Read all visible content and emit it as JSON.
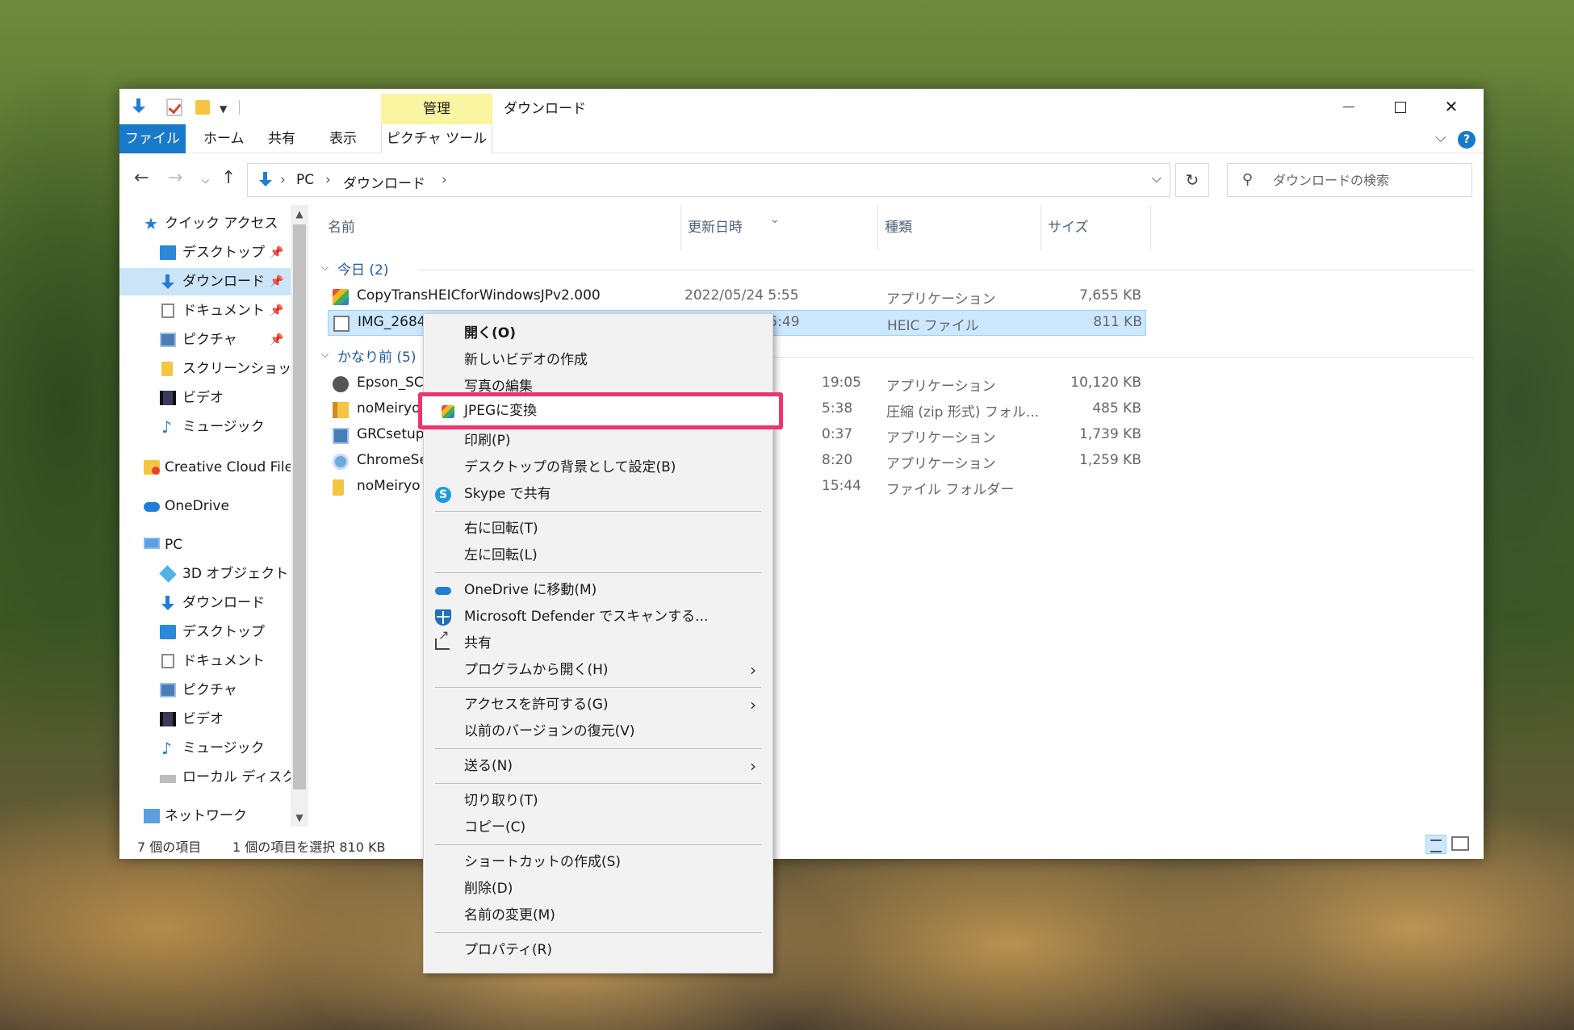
{
  "window": {
    "title": "ダウンロード",
    "manage_tab": "管理",
    "help": "?"
  },
  "ribbon": {
    "tabs": [
      "ファイル",
      "ホーム",
      "共有",
      "表示",
      "ピクチャ ツール"
    ]
  },
  "address": {
    "crumbs": [
      "PC",
      "ダウンロード"
    ],
    "separator": "›"
  },
  "search": {
    "placeholder": "ダウンロードの検索"
  },
  "navpane": {
    "items": [
      {
        "label": "クイック アクセス",
        "icon": "star-icon"
      },
      {
        "label": "デスクトップ",
        "icon": "desktop-icon",
        "pinned": true
      },
      {
        "label": "ダウンロード",
        "icon": "download-icon",
        "pinned": true,
        "selected": true
      },
      {
        "label": "ドキュメント",
        "icon": "document-icon",
        "pinned": true
      },
      {
        "label": "ピクチャ",
        "icon": "pictures-icon",
        "pinned": true
      },
      {
        "label": "スクリーンショット",
        "icon": "folder-icon"
      },
      {
        "label": "ビデオ",
        "icon": "video-icon"
      },
      {
        "label": "ミュージック",
        "icon": "music-icon"
      },
      {
        "label": "Creative Cloud Files",
        "icon": "creative-cloud-icon"
      },
      {
        "label": "OneDrive",
        "icon": "onedrive-icon"
      },
      {
        "label": "PC",
        "icon": "pc-icon"
      },
      {
        "label": "3D オブジェクト",
        "icon": "3d-objects-icon"
      },
      {
        "label": "ダウンロード",
        "icon": "download-icon"
      },
      {
        "label": "デスクトップ",
        "icon": "desktop-icon"
      },
      {
        "label": "ドキュメント",
        "icon": "document-icon"
      },
      {
        "label": "ピクチャ",
        "icon": "pictures-icon"
      },
      {
        "label": "ビデオ",
        "icon": "video-icon"
      },
      {
        "label": "ミュージック",
        "icon": "music-icon"
      },
      {
        "label": "ローカル ディスク (C:)",
        "icon": "local-disk-icon"
      },
      {
        "label": "ネットワーク",
        "icon": "network-icon"
      }
    ]
  },
  "columns": {
    "name": "名前",
    "date": "更新日時",
    "type": "種類",
    "size": "サイズ"
  },
  "groups": {
    "today": "今日 (2)",
    "long_ago": "かなり前 (5)"
  },
  "files_today": [
    {
      "name": "CopyTransHEICforWindowsJPv2.000",
      "date": "2022/05/24 5:55",
      "type": "アプリケーション",
      "size": "7,655 KB",
      "icon": "heic-app-icon"
    },
    {
      "name": "IMG_2684",
      "date": "2022/05/24 5:49",
      "type": "HEIC ファイル",
      "size": "811 KB",
      "icon": "file-icon",
      "selected": true
    }
  ],
  "files_old": [
    {
      "name": "Epson_SC",
      "date": "19:05",
      "type": "アプリケーション",
      "size": "10,120 KB",
      "icon": "epson-icon"
    },
    {
      "name": "noMeiryo",
      "date": "5:38",
      "type": "圧縮 (zip 形式) フォル...",
      "size": "485 KB",
      "icon": "zip-icon"
    },
    {
      "name": "GRCsetup",
      "date": "0:37",
      "type": "アプリケーション",
      "size": "1,739 KB",
      "icon": "grc-icon"
    },
    {
      "name": "ChromeSe",
      "date": "8:20",
      "type": "アプリケーション",
      "size": "1,259 KB",
      "icon": "chrome-setup-icon"
    },
    {
      "name": "noMeiryo",
      "date": "15:44",
      "type": "ファイル フォルダー",
      "size": "",
      "icon": "folder-icon"
    }
  ],
  "status": {
    "count": "7 個の項目",
    "selection": "1 個の項目を選択  810 KB"
  },
  "context_menu": {
    "open": "開く(O)",
    "new_video": "新しいビデオの作成",
    "edit_photo": "写真の編集",
    "convert_jpeg": "JPEGに変換",
    "print": "印刷(P)",
    "set_background": "デスクトップの背景として設定(B)",
    "skype_share": "Skype で共有",
    "rotate_right": "右に回転(T)",
    "rotate_left": "左に回転(L)",
    "move_onedrive": "OneDrive に移動(M)",
    "defender_scan": "Microsoft Defender でスキャンする...",
    "share": "共有",
    "open_with": "プログラムから開く(H)",
    "give_access": "アクセスを許可する(G)",
    "restore_versions": "以前のバージョンの復元(V)",
    "send_to": "送る(N)",
    "cut": "切り取り(T)",
    "copy": "コピー(C)",
    "create_shortcut": "ショートカットの作成(S)",
    "delete": "削除(D)",
    "rename": "名前の変更(M)",
    "properties": "プロパティ(R)"
  },
  "colors": {
    "accent": "#1979ca",
    "selection": "#cce8ff",
    "highlight_box": "#f0336a",
    "manage_tab": "#faf5a0"
  }
}
